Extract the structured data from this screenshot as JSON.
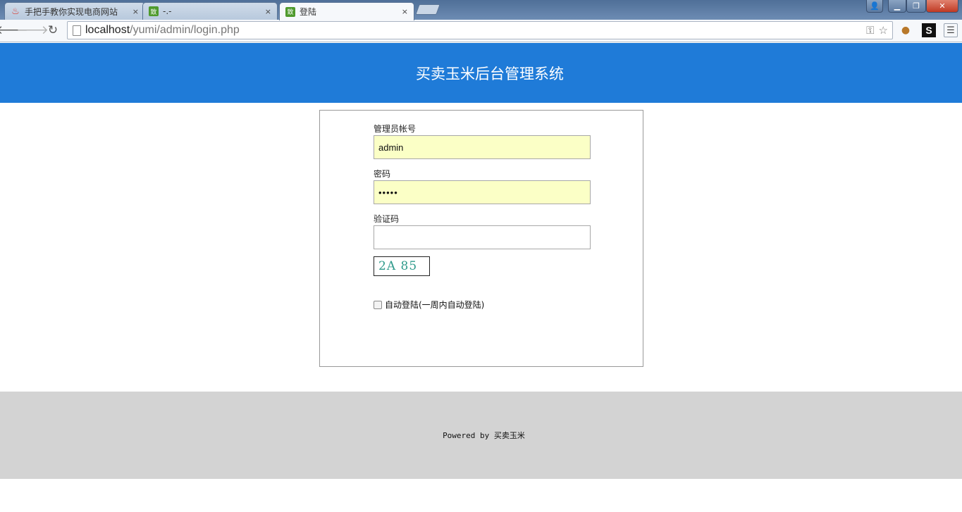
{
  "browser": {
    "tabs": [
      {
        "title": "手把手教你实现电商网站",
        "favicon": "flame-icon",
        "active": false
      },
      {
        "title": "-.-",
        "favicon": "green-badge-icon",
        "active": false
      },
      {
        "title": "登陆",
        "favicon": "green-badge-icon",
        "active": true
      }
    ],
    "favicon_text": "致",
    "tab_close": "×",
    "url_host": "localhost",
    "url_path": "/yumi/admin/login.php",
    "ext_s_label": "S"
  },
  "header": {
    "title": "买卖玉米后台管理系统"
  },
  "login": {
    "account_label": "管理员帐号",
    "account_value": "admin",
    "password_label": "密码",
    "password_value": "•••••",
    "captcha_label": "验证码",
    "captcha_value": "",
    "captcha_image_text": "2A 85",
    "remember_label": "自动登陆(一周内自动登陆)",
    "remember_checked": false
  },
  "footer": {
    "text": "Powered by 买卖玉米"
  },
  "colors": {
    "header_bg": "#1f7bd8",
    "footer_bg": "#d3d3d3",
    "autofill_bg": "#fbffc6"
  }
}
